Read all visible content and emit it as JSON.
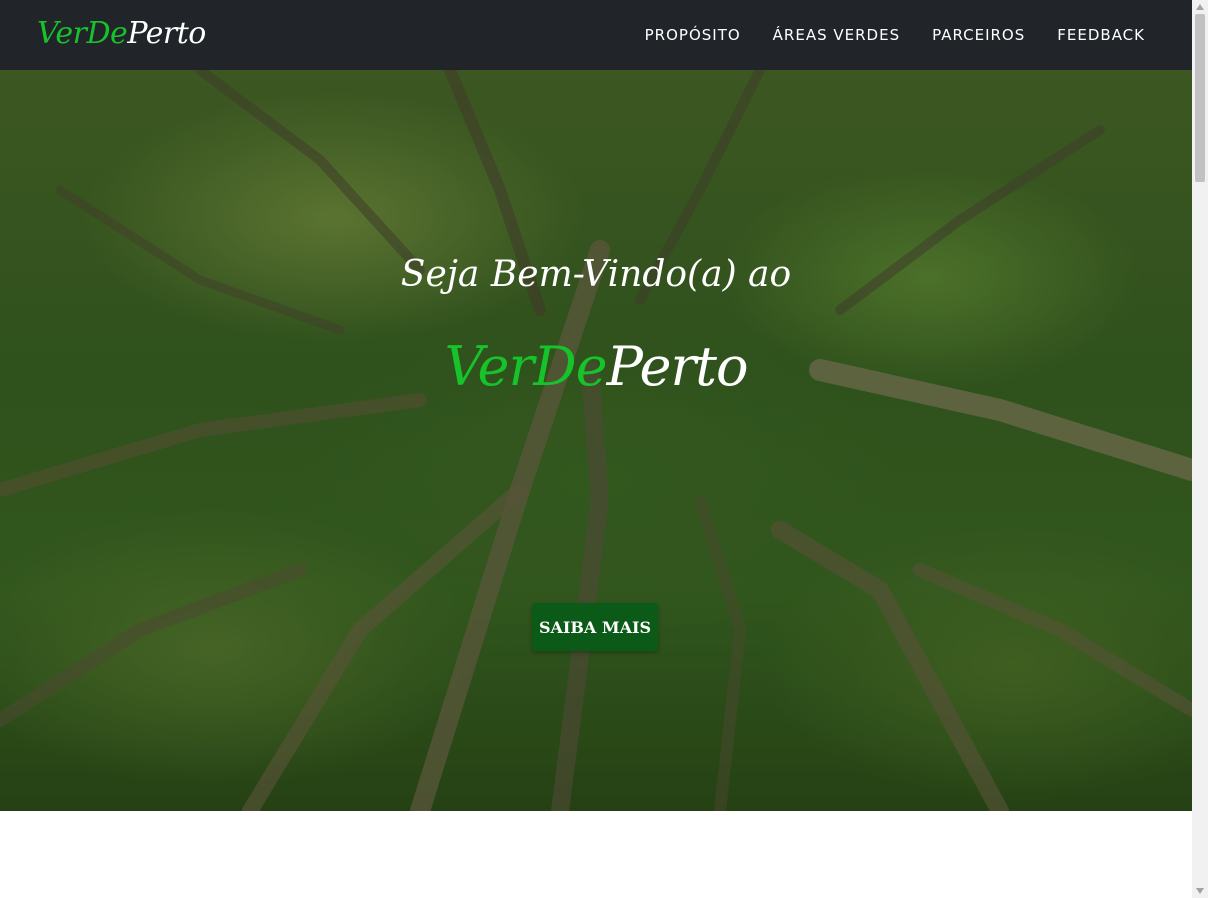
{
  "navbar": {
    "brand": {
      "part1": "VerDe",
      "part2": "Perto"
    },
    "links": [
      "PROPÓSITO",
      "ÁREAS VERDES",
      "PARCEIROS",
      "FEEDBACK"
    ]
  },
  "hero": {
    "title": "Seja Bem-Vindo(a) ao",
    "brand": {
      "part1": "VerDe",
      "part2": "Perto"
    },
    "button": "SAIBA MAIS"
  },
  "colors": {
    "navbar_bg": "#212529",
    "brand_green": "#16c32a",
    "button_bg": "#0c5a17",
    "text_white": "#ffffff"
  },
  "icons": {
    "background": "forest-canopy-image",
    "scroll_up": "triangle-up-icon",
    "scroll_down": "triangle-down-icon"
  }
}
